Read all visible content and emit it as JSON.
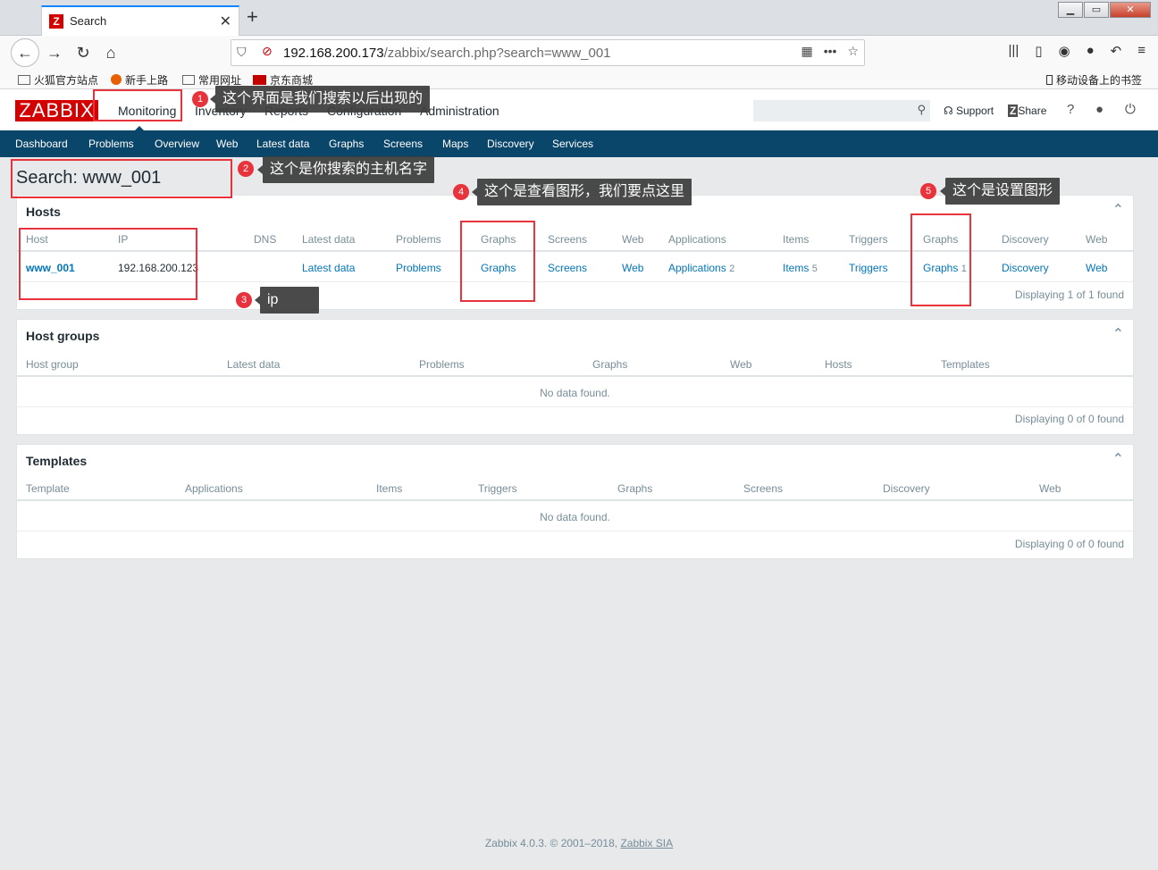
{
  "browser": {
    "tab_title": "Search",
    "tab_favicon": "Z",
    "url_host": "192.168.200.173",
    "url_path": "/zabbix/search.php?search=www_001",
    "bookmarks": [
      "火狐官方站点",
      "新手上路",
      "常用网址",
      "京东商城"
    ],
    "mobile_bookmarks": "移动设备上的书签"
  },
  "header": {
    "logo": "ZABBIX",
    "menu": [
      "Monitoring",
      "Inventory",
      "Reports",
      "Configuration",
      "Administration"
    ],
    "support": "Support",
    "share": "Share",
    "help": "?",
    "search_value": ""
  },
  "submenu": [
    "Dashboard",
    "Problems",
    "Overview",
    "Web",
    "Latest data",
    "Graphs",
    "Screens",
    "Maps",
    "Discovery",
    "Services"
  ],
  "page_title": "Search: www_001",
  "hosts": {
    "title": "Hosts",
    "columns": [
      "Host",
      "IP",
      "DNS",
      "Latest data",
      "Problems",
      "Graphs",
      "Screens",
      "Web",
      "Applications",
      "Items",
      "Triggers",
      "Graphs",
      "Discovery",
      "Web"
    ],
    "row": {
      "host": "www_001",
      "ip": "192.168.200.123",
      "dns": "",
      "latest": "Latest data",
      "problems": "Problems",
      "graphs": "Graphs",
      "screens": "Screens",
      "web": "Web",
      "applications": "Applications",
      "applications_count": "2",
      "items": "Items",
      "items_count": "5",
      "triggers": "Triggers",
      "config_graphs": "Graphs",
      "config_graphs_count": "1",
      "discovery": "Discovery",
      "config_web": "Web"
    },
    "footer": "Displaying 1 of 1 found"
  },
  "host_groups": {
    "title": "Host groups",
    "columns": [
      "Host group",
      "Latest data",
      "Problems",
      "Graphs",
      "Web",
      "Hosts",
      "Templates"
    ],
    "empty": "No data found.",
    "footer": "Displaying 0 of 0 found"
  },
  "templates": {
    "title": "Templates",
    "columns": [
      "Template",
      "Applications",
      "Items",
      "Triggers",
      "Graphs",
      "Screens",
      "Discovery",
      "Web"
    ],
    "empty": "No data found.",
    "footer": "Displaying 0 of 0 found"
  },
  "footer": {
    "text": "Zabbix 4.0.3. © 2001–2018, ",
    "link": "Zabbix SIA"
  },
  "annotations": [
    {
      "num": "1",
      "text": "这个界面是我们搜索以后出现的"
    },
    {
      "num": "2",
      "text": "这个是你搜索的主机名字"
    },
    {
      "num": "3",
      "text": "ip"
    },
    {
      "num": "4",
      "text": "这个是查看图形，我们要点这里"
    },
    {
      "num": "5",
      "text": "这个是设置图形"
    }
  ],
  "colors": {
    "zabbix_red": "#d40000",
    "nav_blue": "#0a466a",
    "link_blue": "#0275b8",
    "annotation_red": "#e8323c"
  }
}
